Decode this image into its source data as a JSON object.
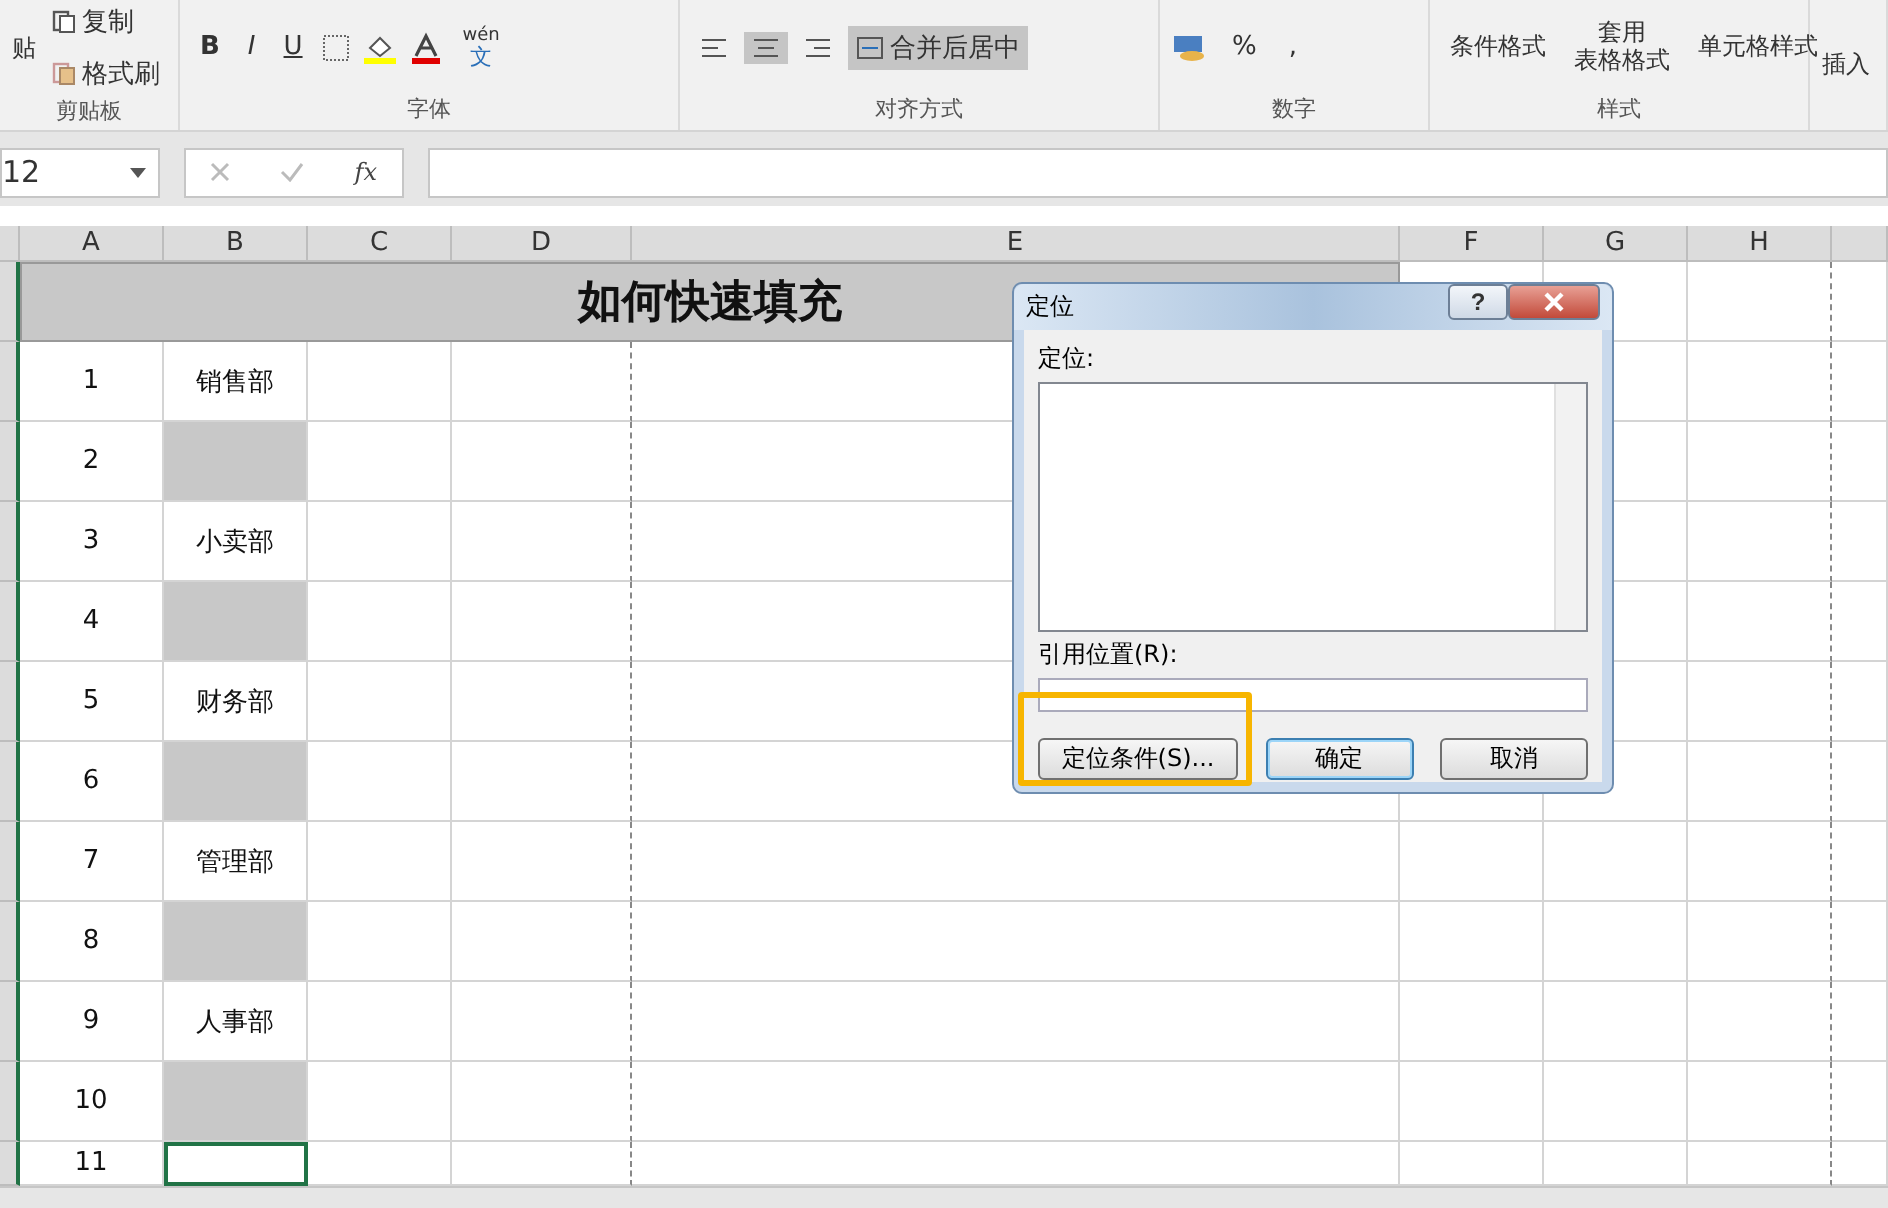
{
  "ribbon": {
    "clipboard": {
      "paste": "贴",
      "items": [
        "复制",
        "格式刷"
      ],
      "label": "剪贴板"
    },
    "font": {
      "buttons": [
        "B",
        "I",
        "U"
      ],
      "phonetic_top": "wén",
      "phonetic_bottom": "文",
      "label": "字体"
    },
    "alignment": {
      "align_buttons": [
        {
          "selected": false
        },
        {
          "selected": true
        },
        {
          "selected": false
        }
      ],
      "merge": "合并后居中",
      "label": "对齐方式"
    },
    "number": {
      "percent": "%",
      "comma": ",",
      "label": "数字"
    },
    "styles": {
      "items": [
        [
          "条件格式"
        ],
        [
          "套用",
          "表格格式"
        ],
        [
          "单元格样式"
        ]
      ],
      "label": "样式"
    },
    "cells": {
      "insert": "插入"
    }
  },
  "formula_bar": {
    "name_box": "12",
    "fx": "fx"
  },
  "sheet": {
    "columns": [
      "A",
      "B",
      "C",
      "D",
      "E",
      "F",
      "G",
      "H"
    ],
    "title": "如何快速填充",
    "rows": [
      {
        "a": "1",
        "b": "销售部",
        "shaded": false,
        "selected": false
      },
      {
        "a": "2",
        "shaded": true,
        "selected": false
      },
      {
        "a": "3",
        "b": "小卖部",
        "shaded": false,
        "selected": false
      },
      {
        "a": "4",
        "shaded": true,
        "selected": false
      },
      {
        "a": "5",
        "b": "财务部",
        "shaded": false,
        "selected": false
      },
      {
        "a": "6",
        "shaded": true,
        "selected": false
      },
      {
        "a": "7",
        "b": "管理部",
        "shaded": false,
        "selected": false
      },
      {
        "a": "8",
        "shaded": true,
        "selected": false
      },
      {
        "a": "9",
        "b": "人事部",
        "shaded": false,
        "selected": false
      },
      {
        "a": "10",
        "shaded": true,
        "selected": false
      },
      {
        "a": "11",
        "shaded": false,
        "selected": true
      }
    ]
  },
  "dialog": {
    "title": "定位",
    "help": "?",
    "list_label": "定位:",
    "ref_label": "引用位置(R):",
    "buttons": [
      {
        "label": "定位条件(S)...",
        "highlighted": true,
        "default": false
      },
      {
        "label": "确定",
        "highlighted": false,
        "default": true
      },
      {
        "label": "取消",
        "highlighted": false,
        "default": false
      }
    ]
  }
}
